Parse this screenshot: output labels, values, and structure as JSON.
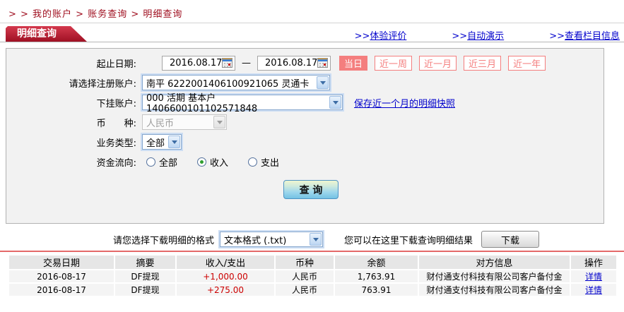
{
  "breadcrumb": {
    "text": "> > 我的账户 > 账务查询 > 明细查询"
  },
  "tab": {
    "label": "明细查询"
  },
  "header_links": {
    "prefix": ">>",
    "items": [
      "体验评价",
      "自动演示",
      "查看栏目信息"
    ]
  },
  "form": {
    "date_row": {
      "label": "起止日期:",
      "from": "2016.08.17",
      "separator": "—",
      "to": "2016.08.17",
      "quick_buttons": [
        {
          "label": "当日",
          "active": true
        },
        {
          "label": "近一周",
          "active": false
        },
        {
          "label": "近一月",
          "active": false
        },
        {
          "label": "近三月",
          "active": false
        },
        {
          "label": "近一年",
          "active": false
        }
      ]
    },
    "register_account": {
      "label": "请选择注册账户:",
      "value": "南平  6222001406100921065  灵通卡"
    },
    "sub_account": {
      "label": "下挂账户:",
      "value": "000  活期  基本户  1406600101102571848",
      "snapshot_link": "保存近一个月的明细快照"
    },
    "currency": {
      "label": "币　　种:",
      "value": "人民币",
      "disabled": true
    },
    "business_type": {
      "label": "业务类型:",
      "value": "全部"
    },
    "fund_flow": {
      "label": "资金流向:",
      "options": [
        {
          "label": "全部",
          "checked": false
        },
        {
          "label": "收入",
          "checked": true
        },
        {
          "label": "支出",
          "checked": false
        }
      ]
    },
    "query_button": "查 询"
  },
  "download": {
    "format_label": "请您选择下载明细的格式",
    "format_value": "文本格式 (.txt)",
    "hint": "您可以在这里下载查询明细结果",
    "button": "下载"
  },
  "table": {
    "headers": [
      "交易日期",
      "摘要",
      "收入/支出",
      "币种",
      "余额",
      "对方信息",
      "操作"
    ],
    "rows": [
      {
        "date": "2016-08-17",
        "summary": "DF提现",
        "amount": "+1,000.00",
        "currency": "人民币",
        "balance": "1,763.91",
        "counterparty": "财付通支付科技有限公司客户备付金",
        "action": "详情"
      },
      {
        "date": "2016-08-17",
        "summary": "DF提现",
        "amount": "+275.00",
        "currency": "人民币",
        "balance": "763.91",
        "counterparty": "财付通支付科技有限公司客户备付金",
        "action": "详情"
      }
    ]
  },
  "colors": {
    "brand_red": "#9d0f22",
    "salmon": "#f47e7e",
    "link_blue": "#0000cc",
    "amount_red": "#cc0000"
  }
}
